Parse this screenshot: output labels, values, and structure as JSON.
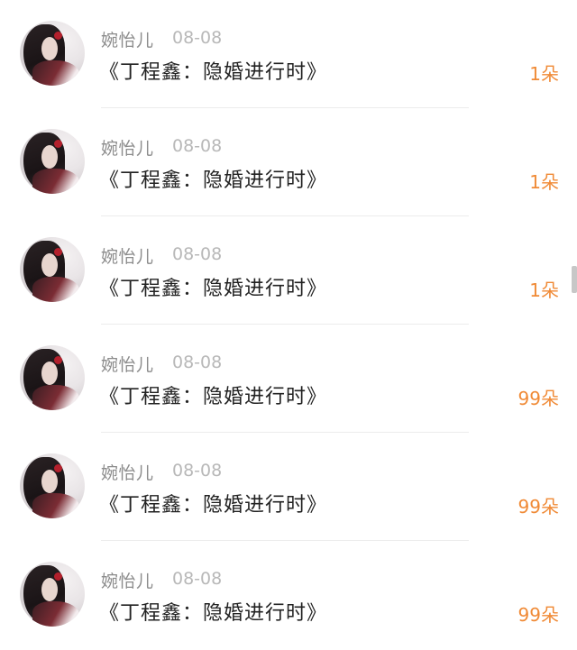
{
  "items": [
    {
      "name": "婉怡儿",
      "date": "08-08",
      "title": "《丁程鑫：隐婚进行时》",
      "count": "1朵"
    },
    {
      "name": "婉怡儿",
      "date": "08-08",
      "title": "《丁程鑫：隐婚进行时》",
      "count": "1朵"
    },
    {
      "name": "婉怡儿",
      "date": "08-08",
      "title": "《丁程鑫：隐婚进行时》",
      "count": "1朵"
    },
    {
      "name": "婉怡儿",
      "date": "08-08",
      "title": "《丁程鑫：隐婚进行时》",
      "count": "99朵"
    },
    {
      "name": "婉怡儿",
      "date": "08-08",
      "title": "《丁程鑫：隐婚进行时》",
      "count": "99朵"
    },
    {
      "name": "婉怡儿",
      "date": "08-08",
      "title": "《丁程鑫：隐婚进行时》",
      "count": "99朵"
    }
  ],
  "colors": {
    "count": "#f08a36",
    "name": "#8c8c8c",
    "date": "#b8b8b8",
    "title": "#222222"
  }
}
